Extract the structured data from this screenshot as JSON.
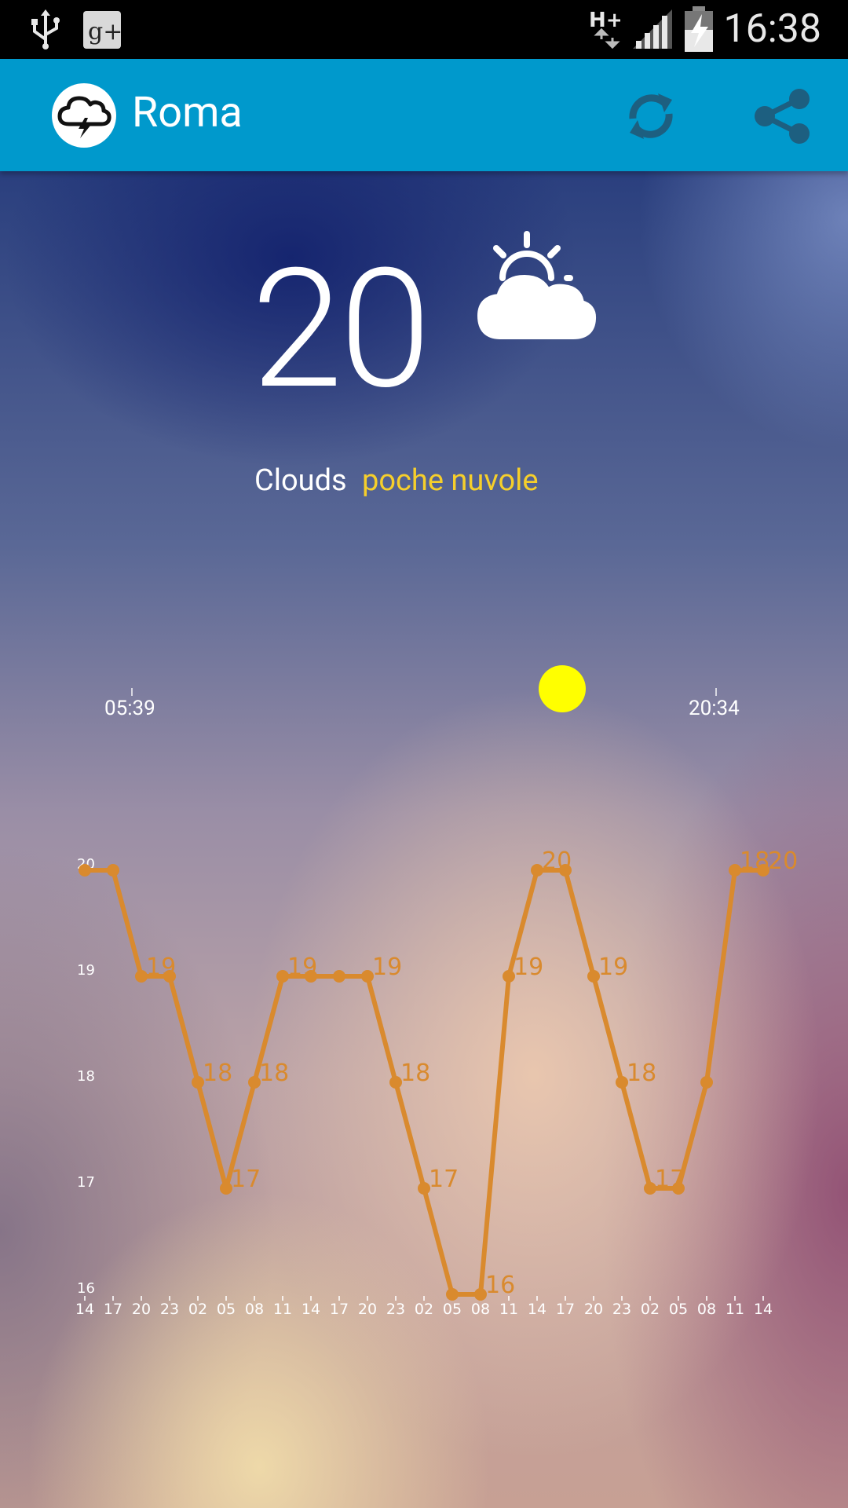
{
  "status_bar": {
    "time": "16:38",
    "network": "H+",
    "icons": [
      "usb-icon",
      "google-plus-icon",
      "network-h-plus-icon",
      "signal-icon",
      "battery-charging-icon"
    ]
  },
  "app_bar": {
    "title": "Roma",
    "icons": [
      "storm-cloud-logo-icon",
      "refresh-icon",
      "share-icon"
    ]
  },
  "current": {
    "temperature": "20",
    "icon": "sun-behind-cloud-icon",
    "condition": "Clouds",
    "description": "poche nuvole"
  },
  "sun": {
    "sunrise": "05:39",
    "sunset": "20:34",
    "indicator_color": "#ffff00"
  },
  "colors": {
    "app_bar": "#0099cc",
    "description": "#f6cf2b",
    "chart_line": "#d98a2e"
  },
  "chart_data": {
    "type": "line",
    "title": "",
    "xlabel": "",
    "ylabel": "",
    "ylim": [
      16,
      20
    ],
    "y_ticks": [
      16,
      17,
      18,
      19,
      20
    ],
    "categories": [
      "14",
      "17",
      "20",
      "23",
      "02",
      "05",
      "08",
      "11",
      "14",
      "17",
      "20",
      "23",
      "02",
      "05",
      "08",
      "11",
      "14",
      "17",
      "20",
      "23",
      "02",
      "05",
      "08",
      "11",
      "14"
    ],
    "series": [
      {
        "values": [
          20,
          20,
          19,
          19,
          18,
          17,
          18,
          19,
          19,
          19,
          19,
          18,
          17,
          16,
          16,
          19,
          20,
          20,
          19,
          18,
          17,
          17,
          18,
          20,
          20
        ],
        "data_labels": [
          {
            "index": 2,
            "text": "19"
          },
          {
            "index": 4,
            "text": "18"
          },
          {
            "index": 5,
            "text": "17"
          },
          {
            "index": 6,
            "text": "18"
          },
          {
            "index": 7,
            "text": "19"
          },
          {
            "index": 10,
            "text": "19"
          },
          {
            "index": 11,
            "text": "18"
          },
          {
            "index": 12,
            "text": "17"
          },
          {
            "index": 14,
            "text": "16"
          },
          {
            "index": 15,
            "text": "19"
          },
          {
            "index": 16,
            "text": "20"
          },
          {
            "index": 18,
            "text": "19"
          },
          {
            "index": 19,
            "text": "18"
          },
          {
            "index": 20,
            "text": "17"
          },
          {
            "index": 23,
            "text": "18"
          },
          {
            "index": 24,
            "text": "20"
          }
        ]
      }
    ],
    "grid": false,
    "legend": "none"
  }
}
